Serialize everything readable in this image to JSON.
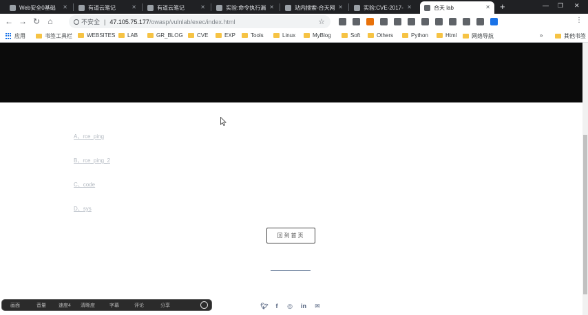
{
  "tabs": [
    {
      "title": "Web安全0基础",
      "favicon_color": "#9aa0a6",
      "active": false
    },
    {
      "title": "有道云笔记",
      "favicon_color": "#9aa0a6",
      "active": false
    },
    {
      "title": "有道云笔记",
      "favicon_color": "#9aa0a6",
      "active": false
    },
    {
      "title": "实验:命令执行漏",
      "favicon_color": "#9aa0a6",
      "active": false
    },
    {
      "title": "站内搜索-合天网",
      "favicon_color": "#9aa0a6",
      "active": false
    },
    {
      "title": "实验:CVE-2017-",
      "favicon_color": "#9aa0a6",
      "active": false
    },
    {
      "title": "合天 lab",
      "favicon_color": "#5f6368",
      "active": true
    }
  ],
  "new_tab": "+",
  "window_controls": [
    "—",
    "❐",
    "✕"
  ],
  "address_bar": {
    "insecure_label": "不安全",
    "separator": "|",
    "host": "47.105.75.177",
    "path": "/owasp/vulnlab/exec/index.html"
  },
  "bookmarks": [
    {
      "label": "应用",
      "type": "apps"
    },
    {
      "label": "书签工具栏",
      "type": "folder"
    },
    {
      "label": "WEBSITES",
      "type": "folder"
    },
    {
      "label": "LAB",
      "type": "folder"
    },
    {
      "label": "GR_BLOG",
      "type": "folder"
    },
    {
      "label": "CVE",
      "type": "folder"
    },
    {
      "label": "EXP",
      "type": "folder"
    },
    {
      "label": "Tools",
      "type": "folder"
    },
    {
      "label": "Linux",
      "type": "folder"
    },
    {
      "label": "MyBlog",
      "type": "folder"
    },
    {
      "label": "Soft",
      "type": "folder"
    },
    {
      "label": "Others",
      "type": "folder"
    },
    {
      "label": "Python",
      "type": "folder"
    },
    {
      "label": "Html",
      "type": "folder"
    },
    {
      "label": "网络导航",
      "type": "folder"
    },
    {
      "label": "»",
      "type": "more"
    },
    {
      "label": "其他书签",
      "type": "folder"
    }
  ],
  "links": [
    {
      "letter": "A、",
      "label": "rce_ping"
    },
    {
      "letter": "B、",
      "label": "rce_ping_2"
    },
    {
      "letter": "C、",
      "label": "code"
    },
    {
      "letter": "D、",
      "label": "sys"
    }
  ],
  "home_button": "回到首页",
  "social_icons": [
    "twitter-icon",
    "facebook-icon",
    "instagram-icon",
    "linkedin-icon",
    "email-icon"
  ],
  "player": {
    "items": [
      "画面",
      "音量",
      "速度4",
      "清晰度",
      "字幕",
      "评论",
      "分享"
    ]
  }
}
